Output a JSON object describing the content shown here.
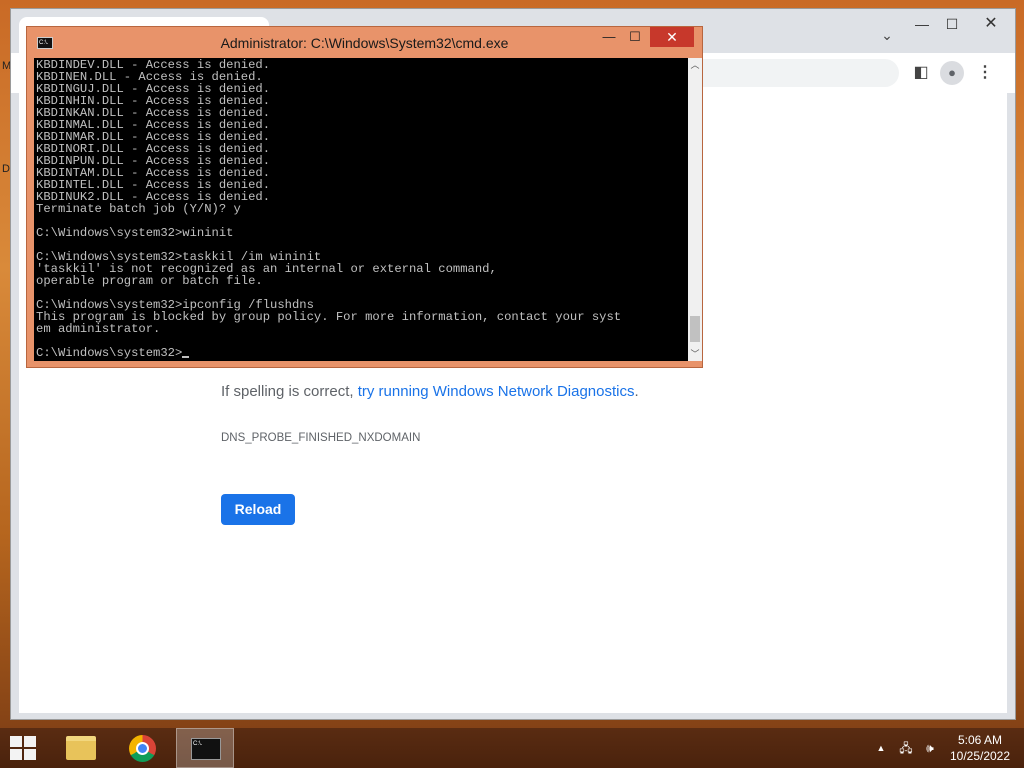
{
  "desktop": {
    "edge_letters": [
      "M",
      "D"
    ]
  },
  "chrome": {
    "window_controls": {
      "minimize": "—",
      "maximize": "☐",
      "close": "✕"
    },
    "tab_search_icon": "chevron-down-icon",
    "toolbar_icons": [
      "side-panel-icon",
      "profile-icon",
      "kebab-menu-icon"
    ],
    "error_page": {
      "spelling_prefix": "If spelling is correct, ",
      "diagnostics_link": "try running Windows Network Diagnostics",
      "suffix": ".",
      "error_code": "DNS_PROBE_FINISHED_NXDOMAIN",
      "reload_label": "Reload"
    },
    "colors": {
      "accent": "#1a73e8",
      "text": "#5f6368"
    }
  },
  "cmd": {
    "title": "Administrator:  C:\\Windows\\System32\\cmd.exe",
    "icon_label": "C:\\.",
    "lines": [
      "KBDINDEV.DLL - Access is denied.",
      "KBDINEN.DLL - Access is denied.",
      "KBDINGUJ.DLL - Access is denied.",
      "KBDINHIN.DLL - Access is denied.",
      "KBDINKAN.DLL - Access is denied.",
      "KBDINMAL.DLL - Access is denied.",
      "KBDINMAR.DLL - Access is denied.",
      "KBDINORI.DLL - Access is denied.",
      "KBDINPUN.DLL - Access is denied.",
      "KBDINTAM.DLL - Access is denied.",
      "KBDINTEL.DLL - Access is denied.",
      "KBDINUK2.DLL - Access is denied.",
      "Terminate batch job (Y/N)? y",
      "",
      "C:\\Windows\\system32>wininit",
      "",
      "C:\\Windows\\system32>taskkil /im wininit",
      "'taskkil' is not recognized as an internal or external command,",
      "operable program or batch file.",
      "",
      "C:\\Windows\\system32>ipconfig /flushdns",
      "This program is blocked by group policy. For more information, contact your syst",
      "em administrator.",
      "",
      "C:\\Windows\\system32>"
    ],
    "colors": {
      "titlebar": "#e8936a",
      "close": "#c7382b",
      "console_bg": "#000000",
      "console_fg": "#c0c0c0"
    }
  },
  "taskbar": {
    "items": [
      {
        "name": "file-explorer",
        "icon": "folder-icon"
      },
      {
        "name": "google-chrome",
        "icon": "chrome-icon"
      },
      {
        "name": "command-prompt",
        "icon": "cmd-icon",
        "active": true
      }
    ],
    "tray": {
      "show_hidden_icon": "▲",
      "network_icon": "network-icon",
      "volume_icon": "volume-icon"
    },
    "clock": {
      "time": "5:06 AM",
      "date": "10/25/2022"
    }
  }
}
